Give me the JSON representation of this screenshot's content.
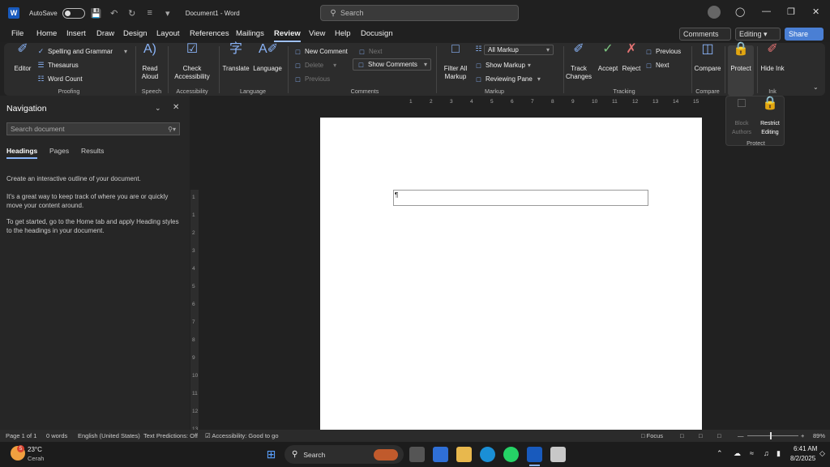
{
  "titlebar": {
    "autosave_label": "AutoSave",
    "doc_title": "Document1 - Word",
    "search_placeholder": "Search"
  },
  "ribbon_tabs": [
    "File",
    "Home",
    "Insert",
    "Draw",
    "Design",
    "Layout",
    "References",
    "Mailings",
    "Review",
    "View",
    "Help",
    "Docusign"
  ],
  "ribbon_right": {
    "comments": "Comments",
    "editing": "Editing",
    "share": "Share"
  },
  "proofing": {
    "editor": "Editor",
    "spelling": "Spelling and Grammar",
    "thesaurus": "Thesaurus",
    "word_count": "Word Count",
    "label": "Proofing"
  },
  "speech": {
    "read_aloud": "Read Aloud",
    "label": "Speech"
  },
  "accessibility": {
    "check": "Check Accessibility",
    "label": "Accessibility"
  },
  "language": {
    "translate": "Translate",
    "language": "Language",
    "label": "Language"
  },
  "comments": {
    "new": "New Comment",
    "delete": "Delete",
    "previous": "Previous",
    "next": "Next",
    "show": "Show Comments",
    "label": "Comments"
  },
  "markup": {
    "filter": "Filter All Markup",
    "all_markup": "All Markup",
    "show_markup": "Show Markup",
    "reviewing_pane": "Reviewing Pane",
    "label": "Markup"
  },
  "tracking": {
    "track_changes": "Track Changes",
    "accept": "Accept",
    "reject": "Reject",
    "previous": "Previous",
    "next": "Next",
    "label": "Tracking"
  },
  "compare": {
    "compare": "Compare",
    "label": "Compare"
  },
  "protect": {
    "protect": "Protect",
    "block_authors": "Block Authors",
    "restrict_editing": "Restrict Editing",
    "label": "Protect"
  },
  "ink": {
    "hide_ink": "Hide Ink",
    "label": "Ink"
  },
  "navigation": {
    "title": "Navigation",
    "search_placeholder": "Search document",
    "tabs": [
      "Headings",
      "Pages",
      "Results"
    ],
    "p1": "Create an interactive outline of your document.",
    "p2": "It's a great way to keep track of where you are or quickly move your content around.",
    "p3": "To get started, go to the Home tab and apply Heading styles to the headings in your document."
  },
  "vruler_ticks": [
    "1",
    "1",
    "2",
    "3",
    "4",
    "5",
    "6",
    "7",
    "8",
    "9",
    "10",
    "11",
    "12",
    "13"
  ],
  "hruler_ticks": [
    "1",
    "2",
    "3",
    "4",
    "5",
    "6",
    "7",
    "8",
    "9",
    "10",
    "11",
    "12",
    "13",
    "14",
    "15"
  ],
  "document": {
    "paragraph_mark": "¶"
  },
  "statusbar": {
    "page": "Page 1 of 1",
    "words": "0 words",
    "language": "English (United States)",
    "predictions": "Text Predictions: Off",
    "accessibility": "Accessibility: Good to go",
    "focus": "Focus",
    "zoom": "89%"
  },
  "taskbar": {
    "temp": "23°C",
    "weather": "Cerah",
    "weather_badge": "5",
    "search": "Search",
    "time": "6:41 AM",
    "date": "8/2/2025"
  }
}
